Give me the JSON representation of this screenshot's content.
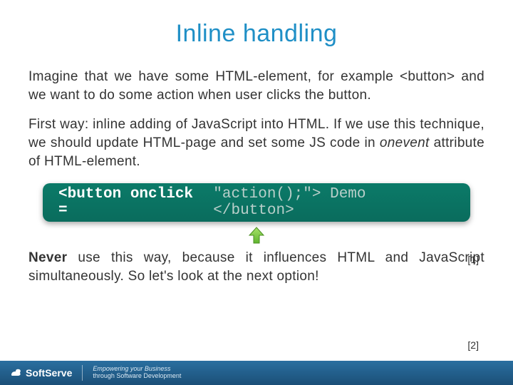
{
  "title": "Inline handling",
  "para1": "Imagine that we have some HTML-element, for example <button> and we want to do some action when user clicks the button.",
  "para2_pre": "First way: inline adding of JavaScript into HTML. If we use this technique, we should update HTML-page and set some JS code in ",
  "para2_em": "onevent",
  "para2_post": " attribute of HTML-element.",
  "code_attr": "<button onclick = ",
  "code_rest": "\"action();\"> Demo </button>",
  "ref1": "[1]",
  "never_label": "Never",
  "para3_rest": " use this way, because it influences HTML and JavaScript simultaneously. So let's look at the next option!",
  "ref2": "[2]",
  "footer_brand": "SoftServe",
  "footer_tag1": "Empowering your Business",
  "footer_tag2": "through Software Development"
}
